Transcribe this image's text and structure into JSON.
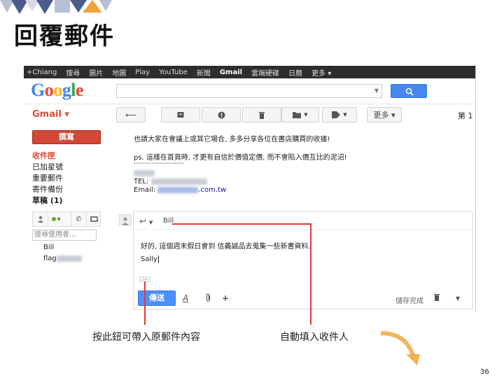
{
  "slide": {
    "title": "回覆郵件",
    "page_number": "36",
    "accent_colors": [
      "#4a5b8c",
      "#f0a33a",
      "#b8c0d6",
      "#d5dae6"
    ]
  },
  "gmail": {
    "topbar": [
      "+Chiang",
      "搜尋",
      "圖片",
      "地圖",
      "Play",
      "YouTube",
      "新聞",
      "Gmail",
      "雲端硬碟",
      "日曆",
      "更多 ▾"
    ],
    "topbar_active": "Gmail",
    "logo_letters": [
      {
        "ch": "G",
        "color": "#4285f4"
      },
      {
        "ch": "o",
        "color": "#ea4335"
      },
      {
        "ch": "o",
        "color": "#fbbc05"
      },
      {
        "ch": "g",
        "color": "#4285f4"
      },
      {
        "ch": "l",
        "color": "#34a853"
      },
      {
        "ch": "e",
        "color": "#ea4335"
      }
    ],
    "search": {
      "value": "",
      "button_icon": "search-icon"
    },
    "app_label": "Gmail ▾",
    "toolbar": {
      "back_icon": "back-arrow-icon",
      "archive_icon": "archive-icon",
      "spam_icon": "report-spam-icon",
      "delete_icon": "trash-icon",
      "folder_icon": "folder-icon",
      "label_icon": "label-icon",
      "more_label": "更多 ▾",
      "page_indicator": "第 1 ↓"
    },
    "sidebar": {
      "compose_label": "撰寫",
      "items": [
        {
          "label": "收件匣",
          "style": "active"
        },
        {
          "label": "已加星號",
          "style": ""
        },
        {
          "label": "重要郵件",
          "style": ""
        },
        {
          "label": "寄件備份",
          "style": ""
        },
        {
          "label": "草稿 (1)",
          "style": "bold"
        }
      ],
      "people_search_placeholder": "搜尋使用者...",
      "contacts": [
        "Bill",
        "flag"
      ]
    },
    "message": {
      "line1": "也請大家在會議上或其它場合, 多多分享各位在書店購買的收據!",
      "line2": "ps. 這樣在首頁時, 才更有自信於價值定價, 而不會陷入價互比的泥沼!",
      "divider": "--------------------",
      "tel_label": "TEL:",
      "email_label": "Email:",
      "email_suffix": ".com.tw"
    },
    "reply": {
      "to": "Bill",
      "line1": "好的, 這個週末假日會到 信義誠品去蒐集一些新書資料.",
      "line2": "Sally",
      "ellipsis": "...",
      "send_label": "傳送",
      "save_status": "儲存完成"
    }
  },
  "annotations": {
    "left_caption": "按此鈕可帶入原郵件內容",
    "right_caption": "自動填入收件人"
  }
}
